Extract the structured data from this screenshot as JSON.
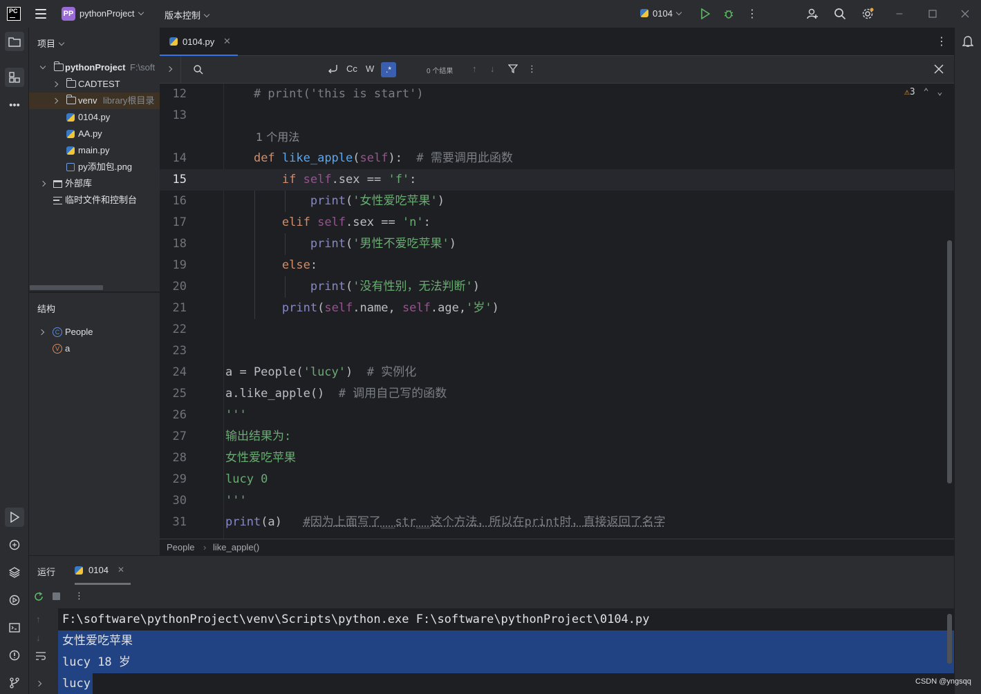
{
  "titlebar": {
    "logo_text": "PC",
    "project_badge": "PP",
    "project_name": "pythonProject",
    "vcs_menu": "版本控制",
    "run_config": "0104"
  },
  "project_panel": {
    "title": "项目",
    "root": {
      "name": "pythonProject",
      "path": "F:\\soft"
    },
    "items": [
      {
        "name": "CADTEST",
        "type": "folder"
      },
      {
        "name": "venv",
        "hint": "library根目录",
        "type": "folder"
      },
      {
        "name": "0104.py",
        "type": "python"
      },
      {
        "name": "AA.py",
        "type": "python"
      },
      {
        "name": "main.py",
        "type": "python"
      },
      {
        "name": "py添加包.png",
        "type": "image"
      }
    ],
    "external_libs": "外部库",
    "scratches": "临时文件和控制台"
  },
  "structure_panel": {
    "title": "结构",
    "items": [
      {
        "badge": "C",
        "name": "People"
      },
      {
        "badge": "V",
        "name": "a"
      }
    ]
  },
  "editor": {
    "tab_label": "0104.py",
    "find": {
      "cc": "Cc",
      "w": "W",
      "regex": ".*",
      "results": "0 个结果"
    },
    "warnings": "3",
    "usage_hint": "1 个用法",
    "line_numbers": [
      "12",
      "13",
      "14",
      "15",
      "16",
      "17",
      "18",
      "19",
      "20",
      "21",
      "22",
      "23",
      "24",
      "25",
      "26",
      "27",
      "28",
      "29",
      "30",
      "31"
    ],
    "current_line": "15"
  },
  "breadcrumb": {
    "class_name": "People",
    "method_name": "like_apple()"
  },
  "run_panel": {
    "title": "运行",
    "tab_label": "0104",
    "console_lines": [
      "F:\\software\\pythonProject\\venv\\Scripts\\python.exe F:\\software\\pythonProject\\0104.py",
      "女性爱吃苹果",
      "lucy 18 岁",
      "lucy"
    ]
  },
  "watermark": "CSDN @yngsqq"
}
